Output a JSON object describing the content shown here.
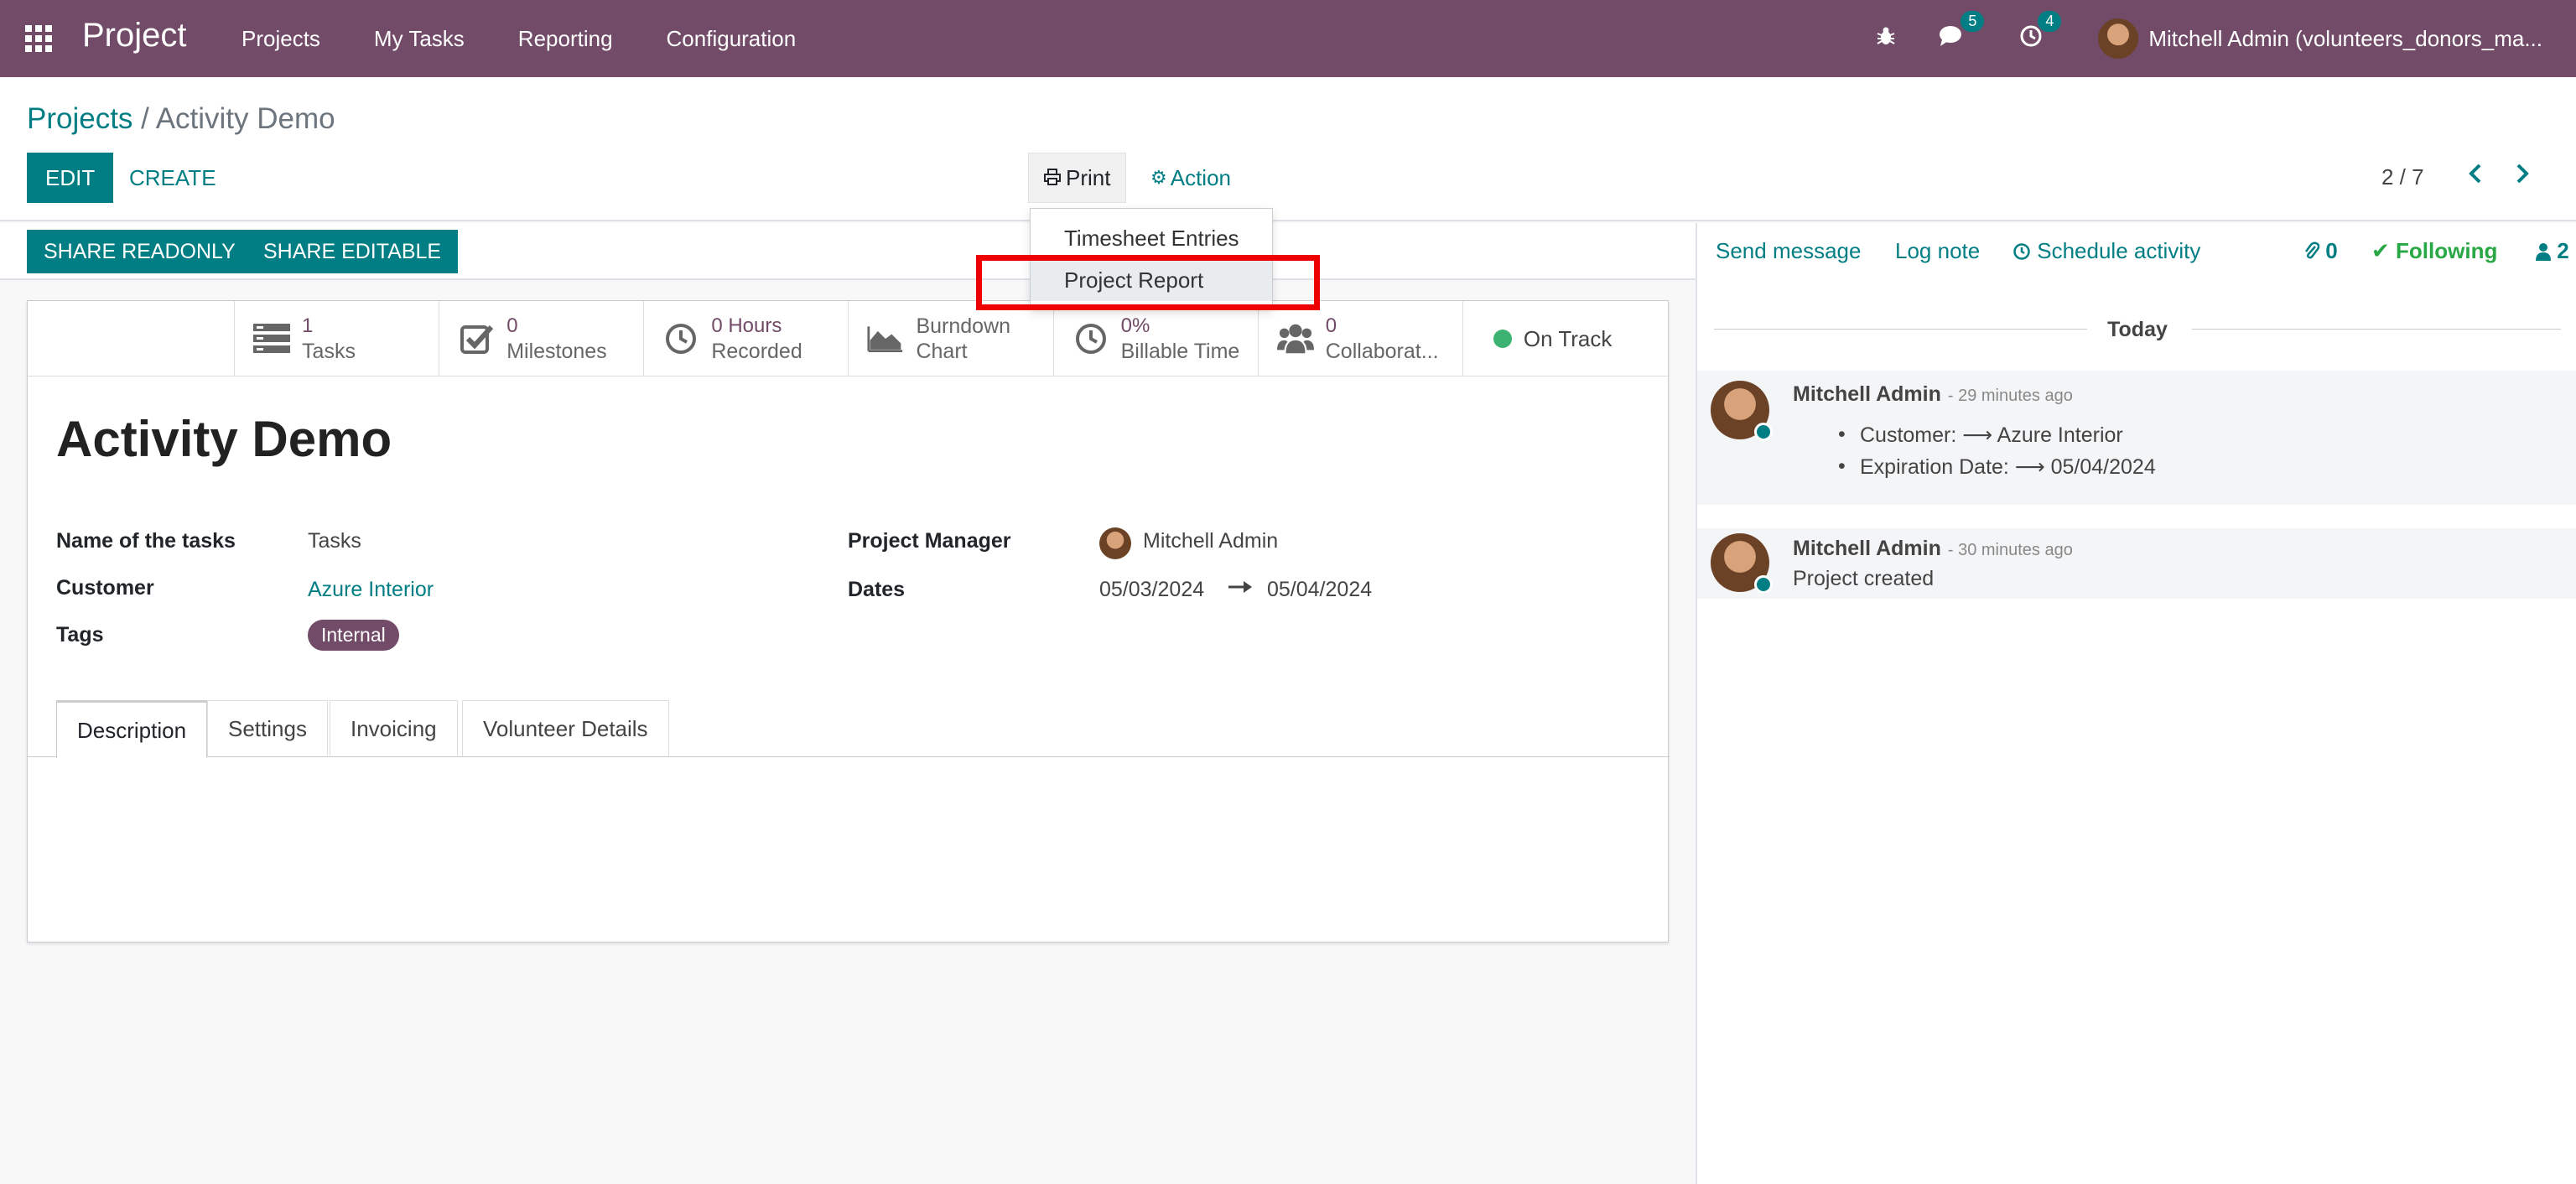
{
  "navbar": {
    "app_name": "Project",
    "menu": [
      "Projects",
      "My Tasks",
      "Reporting",
      "Configuration"
    ],
    "messages_count": "5",
    "activities_count": "4",
    "user_name": "Mitchell Admin (volunteers_donors_ma..."
  },
  "breadcrumb": {
    "parent": "Projects",
    "separator": " / ",
    "current": "Activity Demo"
  },
  "toolbar": {
    "edit": "EDIT",
    "create": "CREATE",
    "print": "Print",
    "action": "Action",
    "pager": "2 / 7"
  },
  "print_menu": [
    "Timesheet Entries",
    "Project Report"
  ],
  "statusbar": {
    "share_readonly": "SHARE READONLY",
    "share_editable": "SHARE EDITABLE"
  },
  "stats": [
    {
      "value": "1",
      "label": "Tasks",
      "icon": "tasks-icon"
    },
    {
      "value": "0",
      "label": "Milestones",
      "icon": "check-square-icon"
    },
    {
      "value": "0 Hours",
      "label": "Recorded",
      "icon": "clock-icon"
    },
    {
      "value": "Burndown",
      "label": "Chart",
      "icon": "area-chart-icon"
    },
    {
      "value": "0%",
      "label": "Billable Time",
      "icon": "clock-icon"
    },
    {
      "value": "0",
      "label": "Collaborat...",
      "icon": "users-icon"
    }
  ],
  "status": {
    "label": "On Track",
    "color": "#3cb371"
  },
  "record": {
    "title": "Activity Demo",
    "fields": {
      "tasks_name_label": "Name of the tasks",
      "tasks_name": "Tasks",
      "customer_label": "Customer",
      "customer": "Azure Interior",
      "tags_label": "Tags",
      "tag": "Internal",
      "pm_label": "Project Manager",
      "pm": "Mitchell Admin",
      "dates_label": "Dates",
      "date_start": "05/03/2024",
      "date_end": "05/04/2024"
    }
  },
  "tabs": [
    "Description",
    "Settings",
    "Invoicing",
    "Volunteer Details"
  ],
  "chatter": {
    "send_message": "Send message",
    "log_note": "Log note",
    "schedule_activity": "Schedule activity",
    "attachments": "0",
    "following": "Following",
    "followers": "2",
    "today": "Today",
    "messages": [
      {
        "author": "Mitchell Admin",
        "time": "- 29 minutes ago",
        "lines": [
          "Customer: ⟶ Azure Interior",
          "Expiration Date: ⟶ 05/04/2024"
        ]
      },
      {
        "author": "Mitchell Admin",
        "time": "- 30 minutes ago",
        "body": "Project created"
      }
    ]
  },
  "colors": {
    "brand": "#714b67",
    "accent": "#017e84"
  }
}
